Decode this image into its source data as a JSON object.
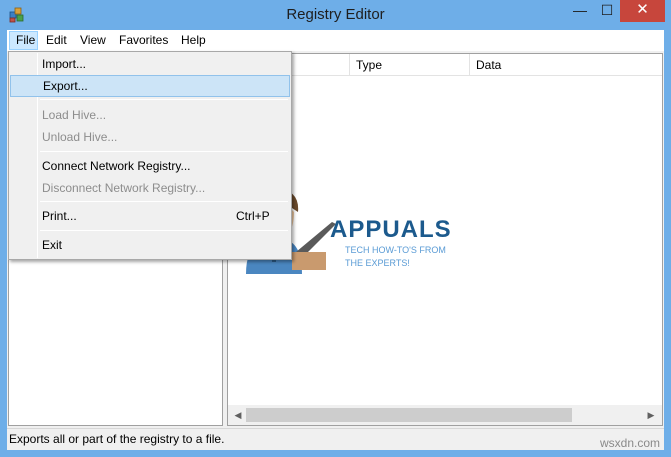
{
  "window": {
    "title": "Registry Editor",
    "minimize_glyph": "—",
    "maximize_glyph": "☐",
    "close_glyph": "✕"
  },
  "menubar": {
    "items": [
      {
        "label": "File"
      },
      {
        "label": "Edit"
      },
      {
        "label": "View"
      },
      {
        "label": "Favorites"
      },
      {
        "label": "Help"
      }
    ]
  },
  "file_menu": {
    "items": [
      {
        "label": "Import...",
        "enabled": true
      },
      {
        "label": "Export...",
        "enabled": true,
        "highlighted": true
      },
      {
        "label": "Load Hive...",
        "enabled": false
      },
      {
        "label": "Unload Hive...",
        "enabled": false
      },
      {
        "label": "Connect Network Registry...",
        "enabled": true
      },
      {
        "label": "Disconnect Network Registry...",
        "enabled": false
      },
      {
        "label": "Print...",
        "enabled": true,
        "shortcut": "Ctrl+P"
      },
      {
        "label": "Exit",
        "enabled": true
      }
    ]
  },
  "columns": {
    "type": "Type",
    "data": "Data"
  },
  "scrollbar": {
    "left_glyph": "◀",
    "right_glyph": "▶"
  },
  "status": {
    "text": "Exports all or part of the registry to a file."
  },
  "logo": {
    "title": "APPUALS",
    "tagline_line1": "TECH HOW-TO'S FROM",
    "tagline_line2": "THE EXPERTS!"
  },
  "watermark": "wsxdn.com",
  "colors": {
    "title_bar": "#6eaee8",
    "close_button": "#c7463c",
    "menu_highlight": "#cce4f7",
    "disabled_text": "#8d8d8d"
  },
  "icons": {
    "app": "registry-editor-icon"
  }
}
